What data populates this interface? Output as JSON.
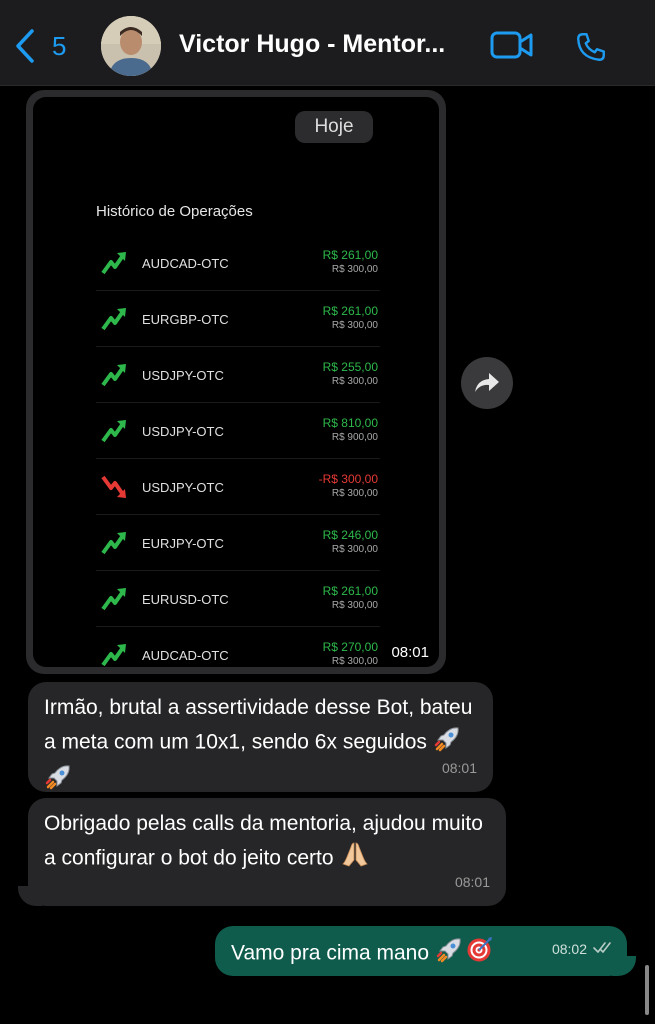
{
  "header": {
    "back_count": "5",
    "contact_name": "Victor Hugo - Mentor..."
  },
  "date_chip": "Hoje",
  "screenshot": {
    "title": "Histórico de Operações",
    "trades": [
      {
        "symbol": "AUDCAD-OTC",
        "result": "R$ 261,00",
        "invested": "R$ 300,00",
        "outcome": "win"
      },
      {
        "symbol": "EURGBP-OTC",
        "result": "R$ 261,00",
        "invested": "R$ 300,00",
        "outcome": "win"
      },
      {
        "symbol": "USDJPY-OTC",
        "result": "R$ 255,00",
        "invested": "R$ 300,00",
        "outcome": "win"
      },
      {
        "symbol": "USDJPY-OTC",
        "result": "R$ 810,00",
        "invested": "R$ 900,00",
        "outcome": "win"
      },
      {
        "symbol": "USDJPY-OTC",
        "result": "-R$ 300,00",
        "invested": "R$ 300,00",
        "outcome": "loss"
      },
      {
        "symbol": "EURJPY-OTC",
        "result": "R$ 246,00",
        "invested": "R$ 300,00",
        "outcome": "win"
      },
      {
        "symbol": "EURUSD-OTC",
        "result": "R$ 261,00",
        "invested": "R$ 300,00",
        "outcome": "win"
      },
      {
        "symbol": "AUDCAD-OTC",
        "result": "R$ 270,00",
        "invested": "R$ 300,00",
        "outcome": "win"
      }
    ],
    "time": "08:01"
  },
  "messages": [
    {
      "text": "Irmão, brutal a assertividade desse Bot, bateu a meta com um 10x1, sendo 6x seguidos",
      "emoji": [
        "rocket-icon",
        "rocket-icon"
      ],
      "time": "08:01"
    },
    {
      "text": "Obrigado pelas calls da mentoria, ajudou muito a configurar o bot do jeito certo",
      "emoji": [
        "praying-hands-icon"
      ],
      "time": "08:01"
    },
    {
      "text": "Vamo pra cima mano",
      "emoji": [
        "rocket-icon",
        "target-icon"
      ],
      "time": "08:02",
      "status": "read-ticks"
    }
  ],
  "colors": {
    "accent": "#1d9bf0",
    "incoming_bubble": "#262628",
    "outgoing_bubble": "#0f5c4c",
    "win": "#2eb84b",
    "loss": "#e53935"
  }
}
